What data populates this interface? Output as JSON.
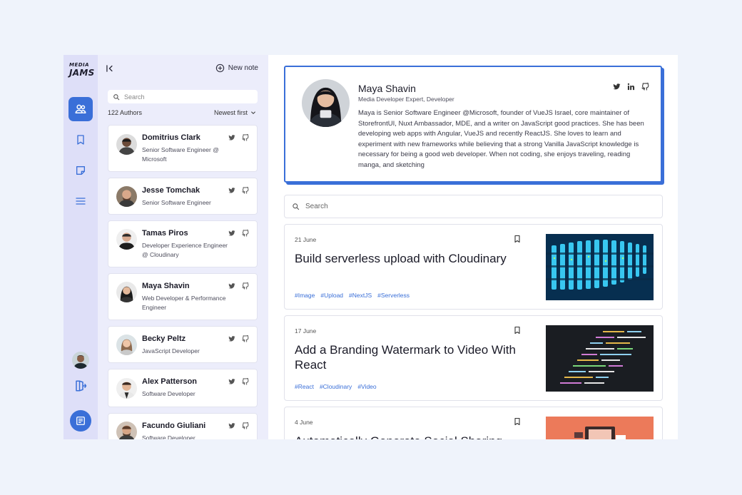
{
  "brand": {
    "line1": "MEDIA",
    "line2": "JAMS"
  },
  "sidebar": {
    "nav": [
      {
        "icon": "users-icon",
        "active": true
      },
      {
        "icon": "bookmark-icon",
        "active": false
      },
      {
        "icon": "note-icon",
        "active": false
      },
      {
        "icon": "menu-icon",
        "active": false
      }
    ]
  },
  "panel": {
    "new_note_label": "New note",
    "search_placeholder": "Search",
    "count_label": "122 Authors",
    "sort_label": "Newest first",
    "authors": [
      {
        "name": "Domitrius Clark",
        "role": "Senior Software Engineer @ Microsoft"
      },
      {
        "name": "Jesse Tomchak",
        "role": "Senior Software Engineer"
      },
      {
        "name": "Tamas Piros",
        "role": "Developer Experience Engineer @ Cloudinary"
      },
      {
        "name": "Maya Shavin",
        "role": "Web Developer & Performance Engineer"
      },
      {
        "name": "Becky Peltz",
        "role": "JavaScript Developer"
      },
      {
        "name": "Alex Patterson",
        "role": "Software Developer"
      },
      {
        "name": "Facundo Giuliani",
        "role": "Software Developer"
      }
    ]
  },
  "profile": {
    "name": "Maya Shavin",
    "title": "Media Developer Expert, Developer",
    "bio": "Maya is Senior Software Engineer @Microsoft, founder of VueJS Israel, core maintainer of StorefrontUI, Nuxt Ambassador, MDE, and a writer on JavaScript good practices. She has been developing web apps with Angular, VueJS and recently ReactJS. She loves to learn and experiment with new frameworks while believing that a strong Vanilla JavaScript knowledge is necessary for being a good web developer. When not coding, she enjoys traveling, reading manga, and sketching"
  },
  "main": {
    "search_placeholder": "Search",
    "articles": [
      {
        "date": "21 June",
        "title": "Build serverless upload with Cloudinary",
        "tags": [
          "#Image",
          "#Upload",
          "#NextJS",
          "#Serverless"
        ]
      },
      {
        "date": "17 June",
        "title": "Add a Branding Watermark to Video With React",
        "tags": [
          "#React",
          "#Cloudinary",
          "#Video"
        ]
      },
      {
        "date": "4 June",
        "title": "Automatically Generate Social Sharing",
        "tags": []
      }
    ]
  },
  "colors": {
    "accent": "#3a6fd8",
    "rail_bg": "#dedff8",
    "panel_bg": "#ecedfb",
    "page_bg": "#eff3fb"
  }
}
